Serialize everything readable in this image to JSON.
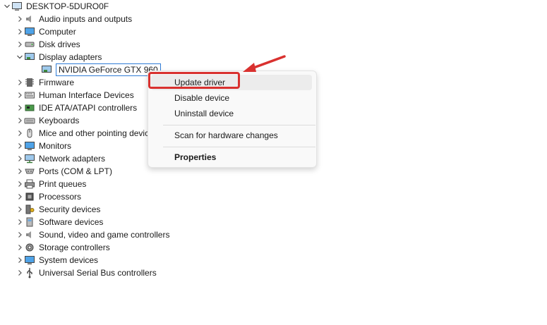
{
  "tree": {
    "root": {
      "label": "DESKTOP-5DURO0F",
      "icon": "computer-icon"
    },
    "categories": [
      {
        "label": "Audio inputs and outputs",
        "icon": "speaker-icon"
      },
      {
        "label": "Computer",
        "icon": "monitor-icon"
      },
      {
        "label": "Disk drives",
        "icon": "disk-drive-icon"
      },
      {
        "label": "Display adapters",
        "icon": "display-adapter-icon",
        "expanded": true,
        "children": [
          {
            "label": "NVIDIA GeForce GTX 960",
            "icon": "display-adapter-icon",
            "selected": true
          }
        ]
      },
      {
        "label": "Firmware",
        "icon": "firmware-icon"
      },
      {
        "label": "Human Interface Devices",
        "icon": "hid-icon"
      },
      {
        "label": "IDE ATA/ATAPI controllers",
        "icon": "ide-controller-icon"
      },
      {
        "label": "Keyboards",
        "icon": "keyboard-icon"
      },
      {
        "label": "Mice and other pointing devices",
        "icon": "mouse-icon"
      },
      {
        "label": "Monitors",
        "icon": "monitor-icon"
      },
      {
        "label": "Network adapters",
        "icon": "network-adapter-icon"
      },
      {
        "label": "Ports (COM & LPT)",
        "icon": "port-icon"
      },
      {
        "label": "Print queues",
        "icon": "printer-icon"
      },
      {
        "label": "Processors",
        "icon": "processor-icon"
      },
      {
        "label": "Security devices",
        "icon": "security-device-icon"
      },
      {
        "label": "Software devices",
        "icon": "software-device-icon"
      },
      {
        "label": "Sound, video and game controllers",
        "icon": "speaker-icon"
      },
      {
        "label": "Storage controllers",
        "icon": "storage-controller-icon"
      },
      {
        "label": "System devices",
        "icon": "system-device-icon"
      },
      {
        "label": "Universal Serial Bus controllers",
        "icon": "usb-icon"
      }
    ]
  },
  "context_menu": {
    "items": [
      {
        "label": "Update driver",
        "highlighted": true
      },
      {
        "label": "Disable device"
      },
      {
        "label": "Uninstall device"
      },
      {
        "label": "Scan for hardware changes"
      },
      {
        "label": "Properties",
        "bold": true
      }
    ]
  },
  "colors": {
    "selection_border": "#2f7bd6",
    "annotation_red": "#d9312f",
    "menu_background": "#f9f9f9"
  }
}
